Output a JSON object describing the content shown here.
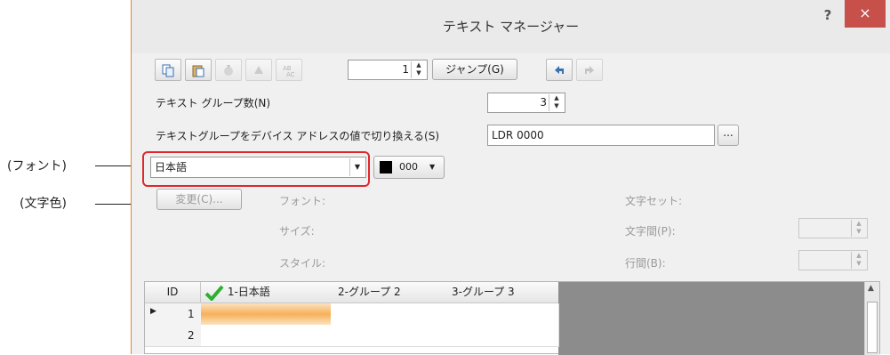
{
  "window": {
    "title": "テキスト マネージャー",
    "help": "?",
    "close": "×"
  },
  "toolbar": {
    "group_value": "1",
    "jump_label": "ジャンプ(G)"
  },
  "group_count": {
    "label": "テキスト グループ数(N)",
    "value": "3"
  },
  "switch_by_address": {
    "label": "テキストグループをデバイス アドレスの値で切り換える(S)",
    "value": "LDR 0000",
    "browse": "..."
  },
  "font_select": {
    "value": "日本語"
  },
  "color_select": {
    "value": "000",
    "swatch": "#000000"
  },
  "font_panel": {
    "change_button": "変更(C)...",
    "font_label": "フォント:",
    "size_label": "サイズ:",
    "style_label": "スタイル:",
    "charset_label": "文字セット:",
    "char_spacing_label": "文字間(P):",
    "line_spacing_label": "行間(B):"
  },
  "annotations": {
    "font": "(フォント)",
    "text_color": "(文字色)"
  },
  "grid": {
    "headers": [
      "ID",
      "1-日本語",
      "2-グループ 2",
      "3-グループ 3"
    ],
    "rows": [
      "1",
      "2"
    ]
  },
  "colors": {
    "callout": "#e0272b",
    "close": "#c7504a",
    "selection": "#f7c480",
    "grid_empty": "#8c8c8c"
  }
}
